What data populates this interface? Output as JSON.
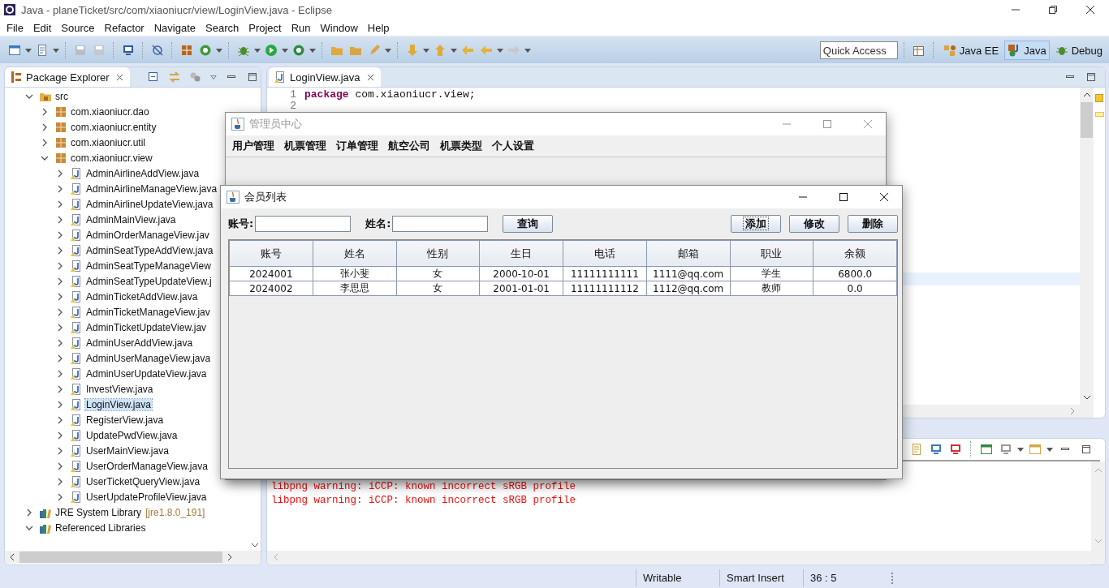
{
  "window": {
    "title": "Java - planeTicket/src/com/xiaoniucr/view/LoginView.java - Eclipse"
  },
  "menu": [
    "File",
    "Edit",
    "Source",
    "Refactor",
    "Navigate",
    "Search",
    "Project",
    "Run",
    "Window",
    "Help"
  ],
  "quick_access": {
    "placeholder": "Quick Access"
  },
  "perspectives": [
    {
      "label": "Java EE",
      "selected": false,
      "kind": "javaee"
    },
    {
      "label": "Java",
      "selected": true,
      "kind": "java"
    },
    {
      "label": "Debug",
      "selected": false,
      "kind": "debug"
    }
  ],
  "package_explorer": {
    "title": "Package Explorer",
    "tree": [
      {
        "label": "src",
        "kind": "source_folder",
        "expanded": true,
        "selected": false,
        "children": [
          {
            "label": "com.xiaoniucr.dao",
            "kind": "package",
            "expanded": false,
            "selected": false
          },
          {
            "label": "com.xiaoniucr.entity",
            "kind": "package",
            "expanded": false,
            "selected": false
          },
          {
            "label": "com.xiaoniucr.util",
            "kind": "package",
            "expanded": false,
            "selected": false
          },
          {
            "label": "com.xiaoniucr.view",
            "kind": "package",
            "expanded": true,
            "selected": false,
            "children": [
              {
                "label": "AdminAirlineAddView.java",
                "kind": "java_file",
                "expanded": false,
                "selected": false
              },
              {
                "label": "AdminAirlineManageView.java",
                "kind": "java_file",
                "expanded": false,
                "selected": false
              },
              {
                "label": "AdminAirlineUpdateView.java",
                "kind": "java_file",
                "expanded": false,
                "selected": false
              },
              {
                "label": "AdminMainView.java",
                "kind": "java_file",
                "expanded": false,
                "selected": false
              },
              {
                "label": "AdminOrderManageView.jav",
                "kind": "java_file",
                "expanded": false,
                "selected": false
              },
              {
                "label": "AdminSeatTypeAddView.java",
                "kind": "java_file",
                "expanded": false,
                "selected": false
              },
              {
                "label": "AdminSeatTypeManageView",
                "kind": "java_file",
                "expanded": false,
                "selected": false
              },
              {
                "label": "AdminSeatTypeUpdateView.j",
                "kind": "java_file",
                "expanded": false,
                "selected": false
              },
              {
                "label": "AdminTicketAddView.java",
                "kind": "java_file",
                "expanded": false,
                "selected": false
              },
              {
                "label": "AdminTicketManageView.jav",
                "kind": "java_file",
                "expanded": false,
                "selected": false
              },
              {
                "label": "AdminTicketUpdateView.jav",
                "kind": "java_file",
                "expanded": false,
                "selected": false
              },
              {
                "label": "AdminUserAddView.java",
                "kind": "java_file",
                "expanded": false,
                "selected": false
              },
              {
                "label": "AdminUserManageView.java",
                "kind": "java_file",
                "expanded": false,
                "selected": false
              },
              {
                "label": "AdminUserUpdateView.java",
                "kind": "java_file",
                "expanded": false,
                "selected": false
              },
              {
                "label": "InvestView.java",
                "kind": "java_file",
                "expanded": false,
                "selected": false
              },
              {
                "label": "LoginView.java",
                "kind": "java_file",
                "expanded": false,
                "selected": true
              },
              {
                "label": "RegisterView.java",
                "kind": "java_file",
                "expanded": false,
                "selected": false
              },
              {
                "label": "UpdatePwdView.java",
                "kind": "java_file",
                "expanded": false,
                "selected": false
              },
              {
                "label": "UserMainView.java",
                "kind": "java_file",
                "expanded": false,
                "selected": false
              },
              {
                "label": "UserOrderManageView.java",
                "kind": "java_file",
                "expanded": false,
                "selected": false
              },
              {
                "label": "UserTicketQueryView.java",
                "kind": "java_file",
                "expanded": false,
                "selected": false
              },
              {
                "label": "UserUpdateProfileView.java",
                "kind": "java_file",
                "expanded": false,
                "selected": false
              }
            ]
          }
        ]
      },
      {
        "label": "JRE System Library",
        "suffix": "[jre1.8.0_191]",
        "kind": "library",
        "expanded": false,
        "selected": false
      },
      {
        "label": "Referenced Libraries",
        "kind": "library",
        "expanded": true,
        "selected": false
      }
    ]
  },
  "editor": {
    "tab": "LoginView.java",
    "lines": [
      {
        "number": "1",
        "keyword": "package",
        "text": " com.xiaoniucr.view;"
      },
      {
        "number": "2"
      }
    ]
  },
  "console": {
    "lines": [
      "libpng warning: iCCP: known incorrect sRGB profile",
      "libpng warning: iCCP: known incorrect sRGB profile"
    ]
  },
  "status_bar": [
    "Writable",
    "Smart Insert",
    "36 : 5"
  ],
  "admin_window": {
    "title": "管理员中心",
    "menu": [
      "用户管理",
      "机票管理",
      "订单管理",
      "航空公司",
      "机票类型",
      "个人设置"
    ]
  },
  "member_window": {
    "title": "会员列表",
    "fields": [
      {
        "label": "账号:"
      },
      {
        "label": "姓名:"
      }
    ],
    "search_button": "查询",
    "buttons": [
      {
        "label": "添加",
        "focused": true
      },
      {
        "label": "修改",
        "focused": false
      },
      {
        "label": "删除",
        "focused": false
      }
    ],
    "table": {
      "columns": [
        "账号",
        "姓名",
        "性别",
        "生日",
        "电话",
        "邮箱",
        "职业",
        "余额"
      ],
      "rows": [
        [
          "2024001",
          "张小斐",
          "女",
          "2000-10-01",
          "11111111111",
          "1111@qq.com",
          "学生",
          "6800.0"
        ],
        [
          "2024002",
          "李思思",
          "女",
          "2001-01-01",
          "11111111112",
          "1112@qq.com",
          "教师",
          "0.0"
        ]
      ]
    }
  }
}
